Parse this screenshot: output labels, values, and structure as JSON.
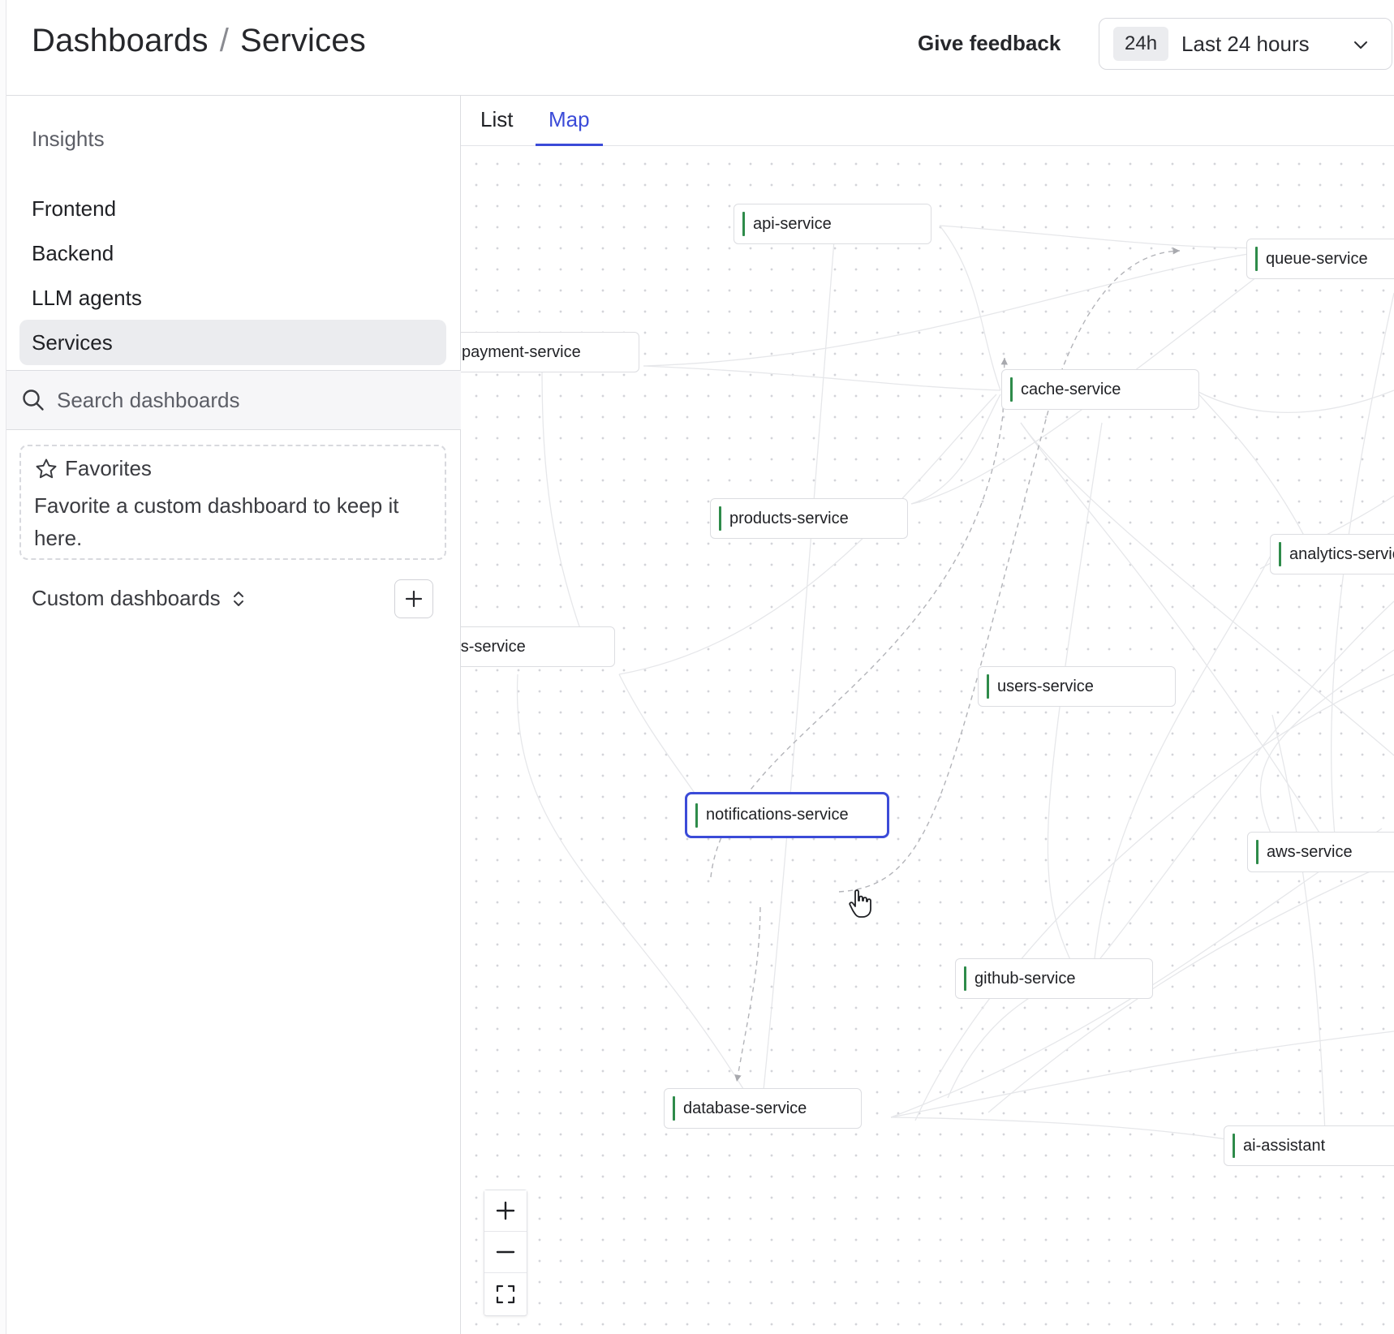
{
  "header": {
    "breadcrumb_root": "Dashboards",
    "breadcrumb_separator": "/",
    "breadcrumb_current": "Services",
    "feedback_label": "Give feedback",
    "time_range_chip": "24h",
    "time_range_label": "Last 24 hours"
  },
  "sidebar": {
    "heading": "Insights",
    "items": [
      {
        "label": "Frontend"
      },
      {
        "label": "Backend"
      },
      {
        "label": "LLM agents"
      },
      {
        "label": "Services"
      }
    ],
    "active_item": "Services",
    "search_placeholder": "Search dashboards",
    "favorites_title": "Favorites",
    "favorites_description": "Favorite a custom dashboard to keep it here.",
    "custom_dashboards_label": "Custom dashboards"
  },
  "main": {
    "tabs": [
      {
        "label": "List"
      },
      {
        "label": "Map"
      }
    ],
    "active_tab": "Map",
    "nodes": {
      "api": "api-service",
      "queue": "queue-service",
      "payment": "payment-service",
      "cache": "cache-service",
      "products": "products-service",
      "analytics": "analytics-service",
      "orders": "orders-service",
      "users": "users-service",
      "notifications": "notifications-service",
      "aws": "aws-service",
      "github": "github-service",
      "database": "database-service",
      "ai": "ai-assistant"
    },
    "selected_node": "notifications-service"
  },
  "colors": {
    "accent": "#3b4bd8",
    "node_status": "#2e8b4a",
    "active_nav_bg": "#ebecef"
  }
}
